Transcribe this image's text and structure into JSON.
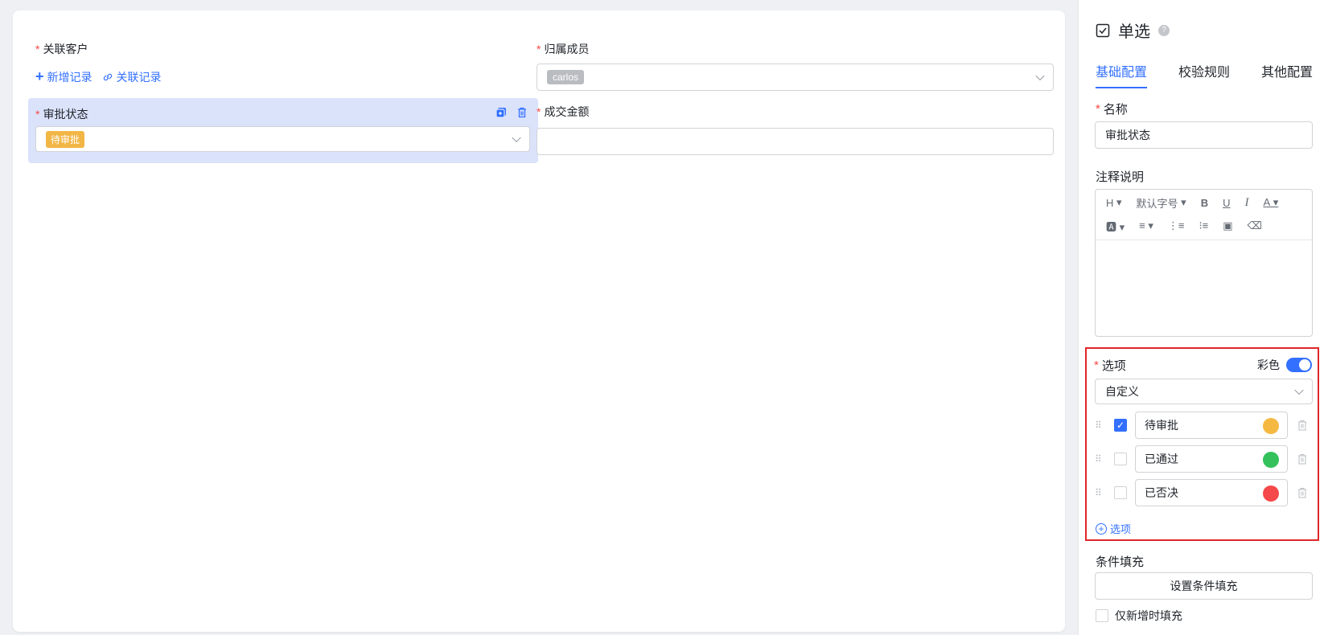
{
  "form": {
    "customer": {
      "label": "关联客户",
      "add_label": "新增记录",
      "link_label": "关联记录"
    },
    "owner": {
      "label": "归属成员",
      "value_tag": "carlos"
    },
    "approval": {
      "label": "审批状态",
      "value_tag": "待审批"
    },
    "amount": {
      "label": "成交金额",
      "value": ""
    }
  },
  "panel": {
    "title": "单选",
    "tabs": [
      {
        "label": "基础配置",
        "active": true
      },
      {
        "label": "校验规则",
        "active": false
      },
      {
        "label": "其他配置",
        "active": false
      }
    ],
    "name_label": "名称",
    "name_value": "审批状态",
    "note_label": "注释说明",
    "toolbar": {
      "heading": "H",
      "font_size": "默认字号"
    },
    "options": {
      "label": "选项",
      "color_label": "彩色",
      "color_on": true,
      "source": "自定义",
      "items": [
        {
          "label": "待审批",
          "checked": true,
          "color": "#f5b942"
        },
        {
          "label": "已通过",
          "checked": false,
          "color": "#34c15b"
        },
        {
          "label": "已否决",
          "checked": false,
          "color": "#f5484a"
        }
      ],
      "add_label": "选项"
    },
    "condition_label": "条件填充",
    "condition_button": "设置条件填充",
    "only_new_label": "仅新增时填充"
  },
  "colors": {
    "accent": "#3370ff",
    "required": "#f54a45",
    "highlight": "#e0262a"
  }
}
